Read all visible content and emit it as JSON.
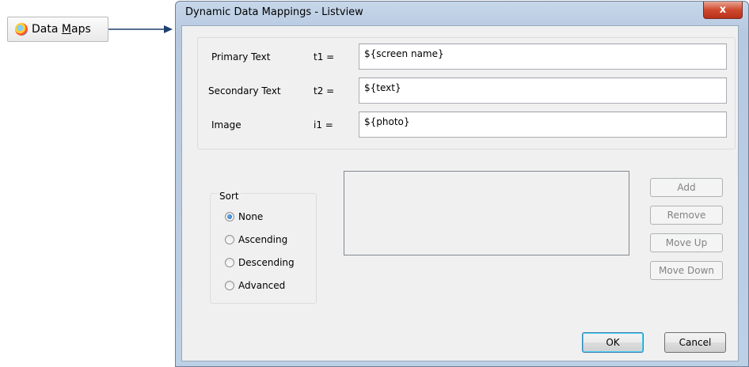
{
  "toolbar_button": {
    "label_prefix": "Data ",
    "label_mnemonic": "M",
    "label_suffix": "aps",
    "icon": "data-maps-icon"
  },
  "dialog": {
    "title": "Dynamic Data Mappings - Listview",
    "close_glyph": "x",
    "mappings": [
      {
        "label": "Primary Text",
        "var": "t1 =",
        "value": "${screen name}"
      },
      {
        "label": "Secondary Text",
        "var": "t2 =",
        "value": "${text}"
      },
      {
        "label": "Image",
        "var": "i1 =",
        "value": "${photo}"
      }
    ],
    "sort": {
      "legend": "Sort",
      "options": [
        "None",
        "Ascending",
        "Descending",
        "Advanced"
      ],
      "selected": "None"
    },
    "side_buttons": {
      "add": "Add",
      "remove": "Remove",
      "move_up": "Move Up",
      "move_down": "Move Down"
    },
    "ok_label": "OK",
    "cancel_label": "Cancel"
  },
  "colors": {
    "arrow": "#1f3f6f",
    "title_bar": "#bfd2e8",
    "close_button": "#c9452b"
  }
}
